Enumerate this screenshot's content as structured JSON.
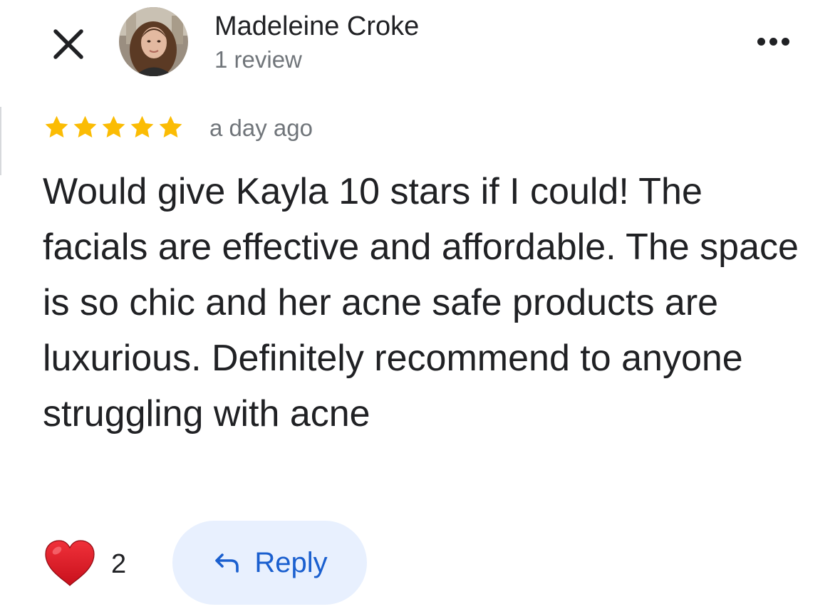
{
  "header": {
    "author_name": "Madeleine Croke",
    "author_meta": "1 review",
    "close_icon": "close-icon",
    "more_icon": "more-horizontal-icon"
  },
  "review": {
    "rating": 5,
    "rating_max": 5,
    "time_ago": "a day ago",
    "text": "Would give Kayla 10 stars if I could! The facials are effective and affordable. The space is so chic and her acne safe products are luxurious. Definitely recommend to anyone struggling with acne"
  },
  "actions": {
    "like_icon": "heart-icon",
    "like_count": "2",
    "reply_icon": "reply-arrow-icon",
    "reply_label": "Reply"
  },
  "colors": {
    "star": "#FBBC04",
    "reply_bg": "#E8F0FE",
    "reply_text": "#1A5FCF",
    "heart": "#E0202B",
    "secondary_text": "#70757A"
  }
}
